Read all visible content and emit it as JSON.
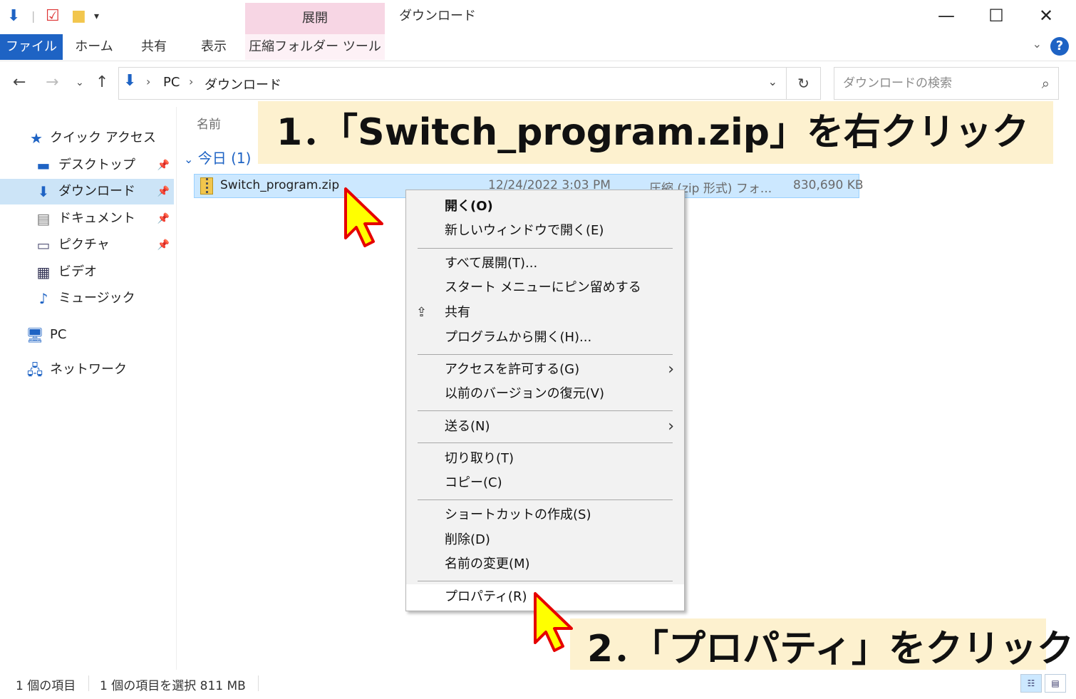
{
  "titlebar": {
    "title": "ダウンロード",
    "context_group": "展開",
    "minimize": "—",
    "maximize": "☐",
    "close": "✕"
  },
  "ribbon": {
    "tabs": [
      {
        "label": "ファイル"
      },
      {
        "label": "ホーム"
      },
      {
        "label": "共有"
      },
      {
        "label": "表示"
      }
    ],
    "context_tab": "圧縮フォルダー ツール",
    "help": "?"
  },
  "address": {
    "segments": [
      "PC",
      "ダウンロード"
    ],
    "search_placeholder": "ダウンロードの検索"
  },
  "sidebar": {
    "items": [
      {
        "label": "クイック アクセス",
        "icon": "star-icon"
      },
      {
        "label": "デスクトップ",
        "icon": "desktop-icon",
        "pinned": true
      },
      {
        "label": "ダウンロード",
        "icon": "download-arrow-icon",
        "pinned": true,
        "selected": true
      },
      {
        "label": "ドキュメント",
        "icon": "document-icon",
        "pinned": true
      },
      {
        "label": "ピクチャ",
        "icon": "picture-icon",
        "pinned": true
      },
      {
        "label": "ビデオ",
        "icon": "video-icon"
      },
      {
        "label": "ミュージック",
        "icon": "music-note-icon"
      },
      {
        "label": "PC",
        "icon": "computer-icon"
      },
      {
        "label": "ネットワーク",
        "icon": "network-icon"
      }
    ]
  },
  "main": {
    "column_name": "名前",
    "group": "今日 (1)",
    "file": {
      "name": "Switch_program.zip",
      "date": "12/24/2022 3:03 PM",
      "type": "圧縮 (zip 形式) フォ...",
      "size": "830,690 KB"
    }
  },
  "context_menu": {
    "groups": [
      [
        {
          "label": "開く(O)",
          "bold": true
        },
        {
          "label": "新しいウィンドウで開く(E)"
        }
      ],
      [
        {
          "label": "すべて展開(T)..."
        },
        {
          "label": "スタート メニューにピン留めする"
        },
        {
          "label": "共有",
          "icon": "share-icon"
        },
        {
          "label": "プログラムから開く(H)..."
        }
      ],
      [
        {
          "label": "アクセスを許可する(G)",
          "submenu": true
        },
        {
          "label": "以前のバージョンの復元(V)"
        }
      ],
      [
        {
          "label": "送る(N)",
          "submenu": true
        }
      ],
      [
        {
          "label": "切り取り(T)"
        },
        {
          "label": "コピー(C)"
        }
      ],
      [
        {
          "label": "ショートカットの作成(S)"
        },
        {
          "label": "削除(D)"
        },
        {
          "label": "名前の変更(M)"
        }
      ],
      [
        {
          "label": "プロパティ(R)",
          "hover": true
        }
      ]
    ]
  },
  "annotations": {
    "step1": "1．「Switch_program.zip」を右クリック",
    "step2": "2．「プロパティ」をクリック"
  },
  "statusbar": {
    "count": "1 個の項目",
    "selection": "1 個の項目を選択  811 MB"
  },
  "colors": {
    "accent": "#1e63c4",
    "selection": "#cce8ff",
    "context_tab": "#f7d6e4",
    "callout_bg": "#fdf1cf",
    "cursor_fill": "#ffff00",
    "cursor_outline": "#e60000"
  }
}
